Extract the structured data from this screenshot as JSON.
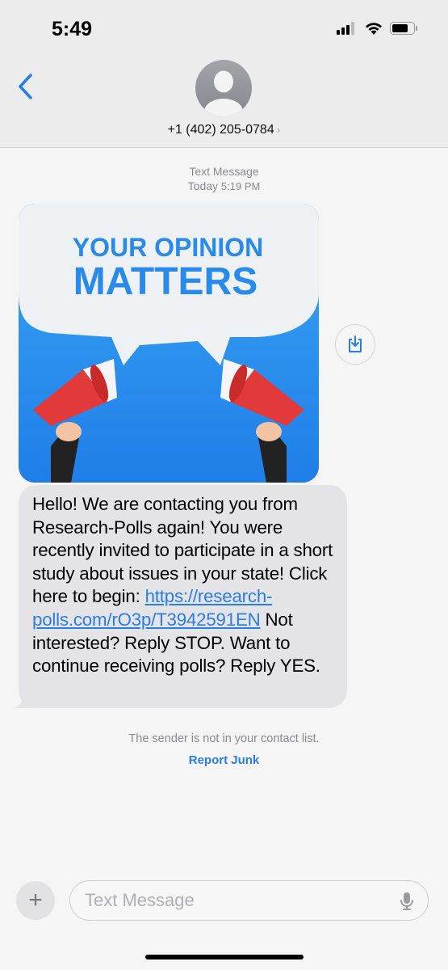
{
  "status_bar": {
    "time": "5:49",
    "icons": [
      "signal-icon",
      "wifi-icon",
      "battery-icon"
    ]
  },
  "header": {
    "contact": "+1 (402) 205-0784",
    "back_icon": "chevron-left-icon",
    "accent": "#2a7de1"
  },
  "thread": {
    "meta_title": "Text Message",
    "meta_day": "Today",
    "meta_time": "5:19 PM",
    "image": {
      "line1": "YOUR OPINION",
      "line2": "MATTERS"
    },
    "message": {
      "text_before": "Hello! We are contacting you from Research-Polls again! You were recently invited to participate in a short study about issues in your state! Click here to begin: ",
      "link": "https://research-polls.com/rO3p/T3942591EN",
      "text_after": " Not interested? Reply STOP. Want to continue receiving polls? Reply YES."
    },
    "notice": "The sender is not in your contact list.",
    "report_junk": "Report Junk"
  },
  "composer": {
    "placeholder": "Text Message"
  }
}
